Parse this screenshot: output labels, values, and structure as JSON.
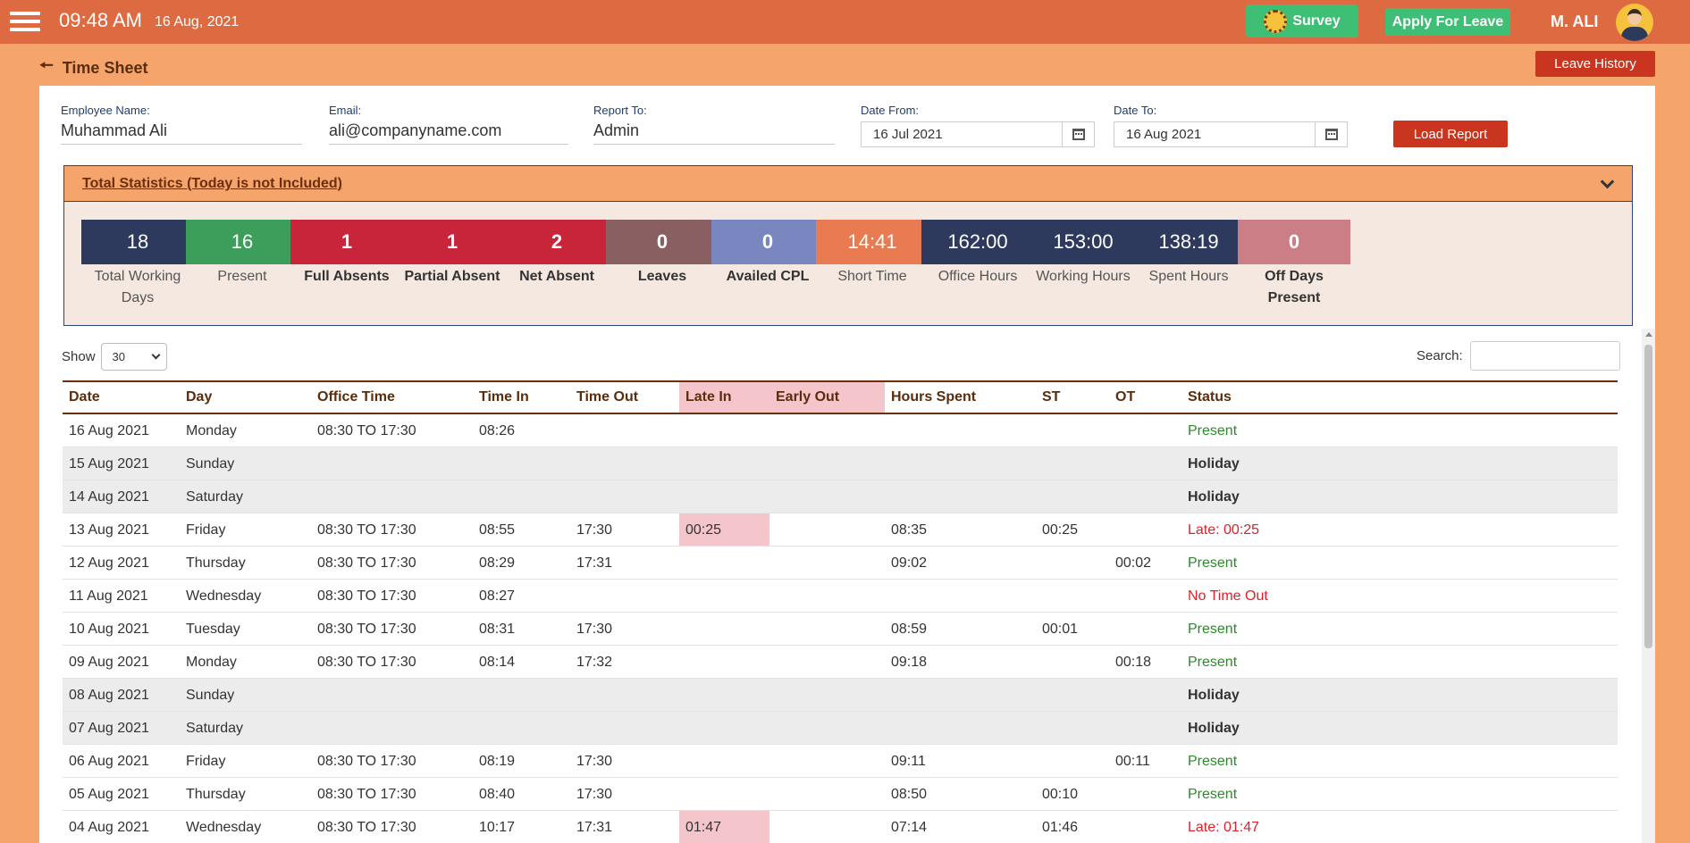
{
  "topbar": {
    "time": "09:48 AM",
    "date": "16 Aug, 2021",
    "survey_label": "Survey",
    "apply_leave_label": "Apply For Leave",
    "user_name": "M. ALI"
  },
  "page": {
    "title": "Time Sheet",
    "leave_history_label": "Leave History"
  },
  "filters": {
    "employee_label": "Employee Name:",
    "employee_value": "Muhammad Ali",
    "email_label": "Email:",
    "email_value": "ali@companyname.com",
    "report_label": "Report To:",
    "report_value": "Admin",
    "date_from_label": "Date From:",
    "date_from_value": "16 Jul 2021",
    "date_to_label": "Date To:",
    "date_to_value": "16 Aug 2021",
    "load_label": "Load Report"
  },
  "stats": {
    "title": "Total Statistics (Today is not Included)",
    "tiles": [
      {
        "value": "18",
        "label": "Total Working Days",
        "color": "#2d3a5e",
        "bold": false
      },
      {
        "value": "16",
        "label": "Present",
        "color": "#3d9e5c",
        "bold": false
      },
      {
        "value": "1",
        "label": "Full Absents",
        "color": "#c8253a",
        "bold": true
      },
      {
        "value": "1",
        "label": "Partial Absent",
        "color": "#c8253a",
        "bold": true
      },
      {
        "value": "2",
        "label": "Net Absent",
        "color": "#c8253a",
        "bold": true
      },
      {
        "value": "0",
        "label": "Leaves",
        "color": "#8a5f62",
        "bold": true
      },
      {
        "value": "0",
        "label": "Availed CPL",
        "color": "#7a86bf",
        "bold": true
      },
      {
        "value": "14:41",
        "label": "Short Time",
        "color": "#e87b52",
        "bold": false
      },
      {
        "value": "162:00",
        "label": "Office Hours",
        "color": "#2d3a5e",
        "bold": false
      },
      {
        "value": "153:00",
        "label": "Working Hours",
        "color": "#2d3a5e",
        "bold": false
      },
      {
        "value": "138:19",
        "label": "Spent Hours",
        "color": "#2d3a5e",
        "bold": false
      },
      {
        "value": "0",
        "label": "Off Days Present",
        "color": "#cc7e86",
        "bold": true
      }
    ]
  },
  "table_controls": {
    "show_label": "Show",
    "show_value": "30",
    "search_label": "Search:"
  },
  "table": {
    "headers": [
      "Date",
      "Day",
      "Office Time",
      "Time In",
      "Time Out",
      "Late In",
      "Early Out",
      "Hours Spent",
      "ST",
      "OT",
      "Status"
    ],
    "rows": [
      {
        "date": "16 Aug 2021",
        "day": "Monday",
        "office": "08:30 TO 17:30",
        "in": "08:26",
        "out": "",
        "late": "",
        "early": "",
        "hours": "",
        "st": "",
        "ot": "",
        "status": "Present",
        "kind": "present"
      },
      {
        "date": "15 Aug 2021",
        "day": "Sunday",
        "office": "",
        "in": "",
        "out": "",
        "late": "",
        "early": "",
        "hours": "",
        "st": "",
        "ot": "",
        "status": "Holiday",
        "kind": "holiday"
      },
      {
        "date": "14 Aug 2021",
        "day": "Saturday",
        "office": "",
        "in": "",
        "out": "",
        "late": "",
        "early": "",
        "hours": "",
        "st": "",
        "ot": "",
        "status": "Holiday",
        "kind": "holiday"
      },
      {
        "date": "13 Aug 2021",
        "day": "Friday",
        "office": "08:30 TO 17:30",
        "in": "08:55",
        "out": "17:30",
        "late": "00:25",
        "early": "",
        "hours": "08:35",
        "st": "00:25",
        "ot": "",
        "status": "Late: 00:25",
        "kind": "late"
      },
      {
        "date": "12 Aug 2021",
        "day": "Thursday",
        "office": "08:30 TO 17:30",
        "in": "08:29",
        "out": "17:31",
        "late": "",
        "early": "",
        "hours": "09:02",
        "st": "",
        "ot": "00:02",
        "status": "Present",
        "kind": "present"
      },
      {
        "date": "11 Aug 2021",
        "day": "Wednesday",
        "office": "08:30 TO 17:30",
        "in": "08:27",
        "out": "",
        "late": "",
        "early": "",
        "hours": "",
        "st": "",
        "ot": "",
        "status": "No Time Out",
        "kind": "notimeout"
      },
      {
        "date": "10 Aug 2021",
        "day": "Tuesday",
        "office": "08:30 TO 17:30",
        "in": "08:31",
        "out": "17:30",
        "late": "",
        "early": "",
        "hours": "08:59",
        "st": "00:01",
        "ot": "",
        "status": "Present",
        "kind": "present"
      },
      {
        "date": "09 Aug 2021",
        "day": "Monday",
        "office": "08:30 TO 17:30",
        "in": "08:14",
        "out": "17:32",
        "late": "",
        "early": "",
        "hours": "09:18",
        "st": "",
        "ot": "00:18",
        "status": "Present",
        "kind": "present"
      },
      {
        "date": "08 Aug 2021",
        "day": "Sunday",
        "office": "",
        "in": "",
        "out": "",
        "late": "",
        "early": "",
        "hours": "",
        "st": "",
        "ot": "",
        "status": "Holiday",
        "kind": "holiday"
      },
      {
        "date": "07 Aug 2021",
        "day": "Saturday",
        "office": "",
        "in": "",
        "out": "",
        "late": "",
        "early": "",
        "hours": "",
        "st": "",
        "ot": "",
        "status": "Holiday",
        "kind": "holiday"
      },
      {
        "date": "06 Aug 2021",
        "day": "Friday",
        "office": "08:30 TO 17:30",
        "in": "08:19",
        "out": "17:30",
        "late": "",
        "early": "",
        "hours": "09:11",
        "st": "",
        "ot": "00:11",
        "status": "Present",
        "kind": "present"
      },
      {
        "date": "05 Aug 2021",
        "day": "Thursday",
        "office": "08:30 TO 17:30",
        "in": "08:40",
        "out": "17:30",
        "late": "",
        "early": "",
        "hours": "08:50",
        "st": "00:10",
        "ot": "",
        "status": "Present",
        "kind": "present"
      },
      {
        "date": "04 Aug 2021",
        "day": "Wednesday",
        "office": "08:30 TO 17:30",
        "in": "10:17",
        "out": "17:31",
        "late": "01:47",
        "early": "",
        "hours": "07:14",
        "st": "01:46",
        "ot": "",
        "status": "Late: 01:47",
        "kind": "late"
      }
    ]
  }
}
